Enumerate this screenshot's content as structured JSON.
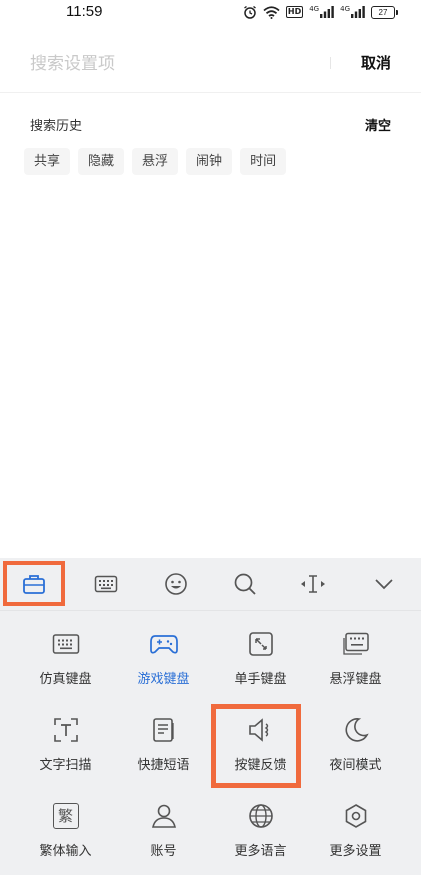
{
  "status_bar": {
    "time": "11:59",
    "hd_label": "HD",
    "signal1_label": "4G",
    "signal2_label": "4G",
    "battery": "27"
  },
  "search": {
    "placeholder": "搜索设置项",
    "cancel_label": "取消"
  },
  "history": {
    "title": "搜索历史",
    "clear_label": "清空",
    "tags": [
      "共享",
      "隐藏",
      "悬浮",
      "闹钟",
      "时间"
    ]
  },
  "toolbar": {
    "items": [
      {
        "icon": "toolbox-icon"
      },
      {
        "icon": "keyboard-icon"
      },
      {
        "icon": "emoji-icon"
      },
      {
        "icon": "search-icon"
      },
      {
        "icon": "cursor-icon"
      },
      {
        "icon": "chevron-down-icon"
      }
    ]
  },
  "grid": {
    "items": [
      {
        "label": "仿真键盘",
        "icon": "keyboard-icon"
      },
      {
        "label": "游戏键盘",
        "icon": "gamepad-icon"
      },
      {
        "label": "单手键盘",
        "icon": "one-hand-icon"
      },
      {
        "label": "悬浮键盘",
        "icon": "floating-keyboard-icon"
      },
      {
        "label": "文字扫描",
        "icon": "text-scan-icon"
      },
      {
        "label": "快捷短语",
        "icon": "phrase-icon"
      },
      {
        "label": "按键反馈",
        "icon": "speaker-icon"
      },
      {
        "label": "夜间模式",
        "icon": "moon-icon"
      },
      {
        "label": "繁体输入",
        "icon": "traditional-icon",
        "glyph": "繁"
      },
      {
        "label": "账号",
        "icon": "user-icon"
      },
      {
        "label": "更多语言",
        "icon": "globe-icon"
      },
      {
        "label": "更多设置",
        "icon": "settings-icon"
      }
    ]
  },
  "colors": {
    "accent": "#2a6fd6",
    "highlight": "#f06a3d",
    "panel_bg": "#eff0f2"
  }
}
